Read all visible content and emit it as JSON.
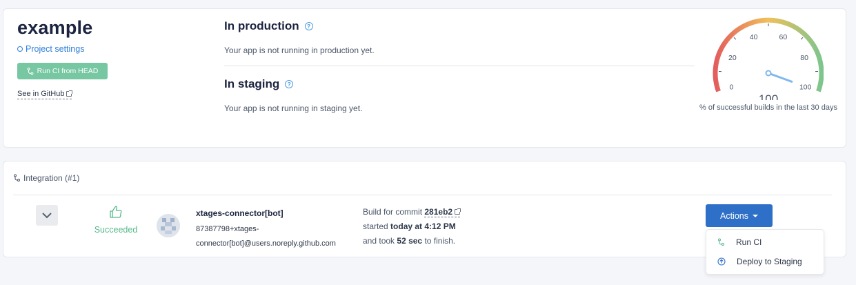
{
  "project": {
    "name": "example",
    "settings_label": "Project settings",
    "run_ci_label": "Run CI from HEAD",
    "github_label": "See in GitHub"
  },
  "environments": {
    "production": {
      "title": "In production",
      "message": "Your app is not running in production yet."
    },
    "staging": {
      "title": "In staging",
      "message": "Your app is not running in staging yet."
    }
  },
  "gauge": {
    "value": 100,
    "value_label": "100",
    "ticks": [
      "0",
      "20",
      "40",
      "60",
      "80",
      "100"
    ],
    "caption": "% of successful builds in the last 30 days",
    "colors": {
      "low": "#e35d5d",
      "mid": "#f0c05a",
      "high": "#7dc58d",
      "needle": "#7fb8ee"
    }
  },
  "builds": {
    "section_label": "Integration (#1)",
    "rows": [
      {
        "status": "Succeeded",
        "author_name": "xtages-connector[bot]",
        "author_email": "87387798+xtages-connector[bot]@users.noreply.github.com",
        "build_prefix": "Build for commit",
        "commit": "281eb2",
        "started_prefix": "started",
        "started_at": "today at 4:12 PM",
        "took_prefix": "and took",
        "duration": "52 sec",
        "took_suffix": "to finish."
      }
    ]
  },
  "actions": {
    "label": "Actions",
    "menu": [
      {
        "label": "Run CI",
        "icon": "branch-icon"
      },
      {
        "label": "Deploy to Staging",
        "icon": "arrow-up-circle-icon"
      }
    ]
  },
  "colors": {
    "accent": "#2e6fc7",
    "success": "#56b88a",
    "run_ci_button": "#76c7a2"
  }
}
